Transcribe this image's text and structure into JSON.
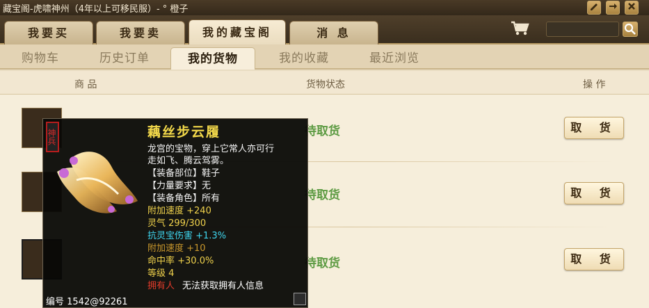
{
  "window": {
    "title": "藏宝阁-虎啸神州（4年以上可移民服）- °  橙子"
  },
  "main_tabs": [
    {
      "label": "我要买",
      "active": false
    },
    {
      "label": "我要卖",
      "active": false
    },
    {
      "label": "我的藏宝阁",
      "active": true
    },
    {
      "label": "消 息",
      "active": false
    }
  ],
  "search": {
    "value": "",
    "placeholder": ""
  },
  "sub_tabs": [
    {
      "label": "购物车",
      "active": false
    },
    {
      "label": "历史订单",
      "active": false
    },
    {
      "label": "我的货物",
      "active": true
    },
    {
      "label": "我的收藏",
      "active": false
    },
    {
      "label": "最近浏览",
      "active": false
    }
  ],
  "columns": {
    "goods": "商 品",
    "status": "货物状态",
    "action": "操 作"
  },
  "rows": [
    {
      "status": "待取货",
      "action": "取 货"
    },
    {
      "status": "待取货",
      "action": "取 货"
    },
    {
      "status": "待取货",
      "action": "取 货"
    }
  ],
  "tooltip": {
    "seal": "神兵",
    "title": "藕丝步云履",
    "desc1": "龙宫的宝物，穿上它常人亦可行",
    "desc2": "走如飞、腾云驾雾。",
    "equip_slot": "【装备部位】鞋子",
    "strength_req": "【力量要求】无",
    "equip_role": "【装备角色】所有",
    "bonus_speed": "附加速度 +240",
    "spirit": "灵气 299/300",
    "resist": "抗灵宝伤害 +1.3%",
    "bonus_speed2": "附加速度 +10",
    "hit_rate": "命中率 +30.0%",
    "level": "等级 4",
    "owner_label": "拥有人",
    "owner_value": "无法获取拥有人信息",
    "serial": "编号 1542@92261"
  },
  "colors": {
    "status_green": "#5d9b43",
    "title_yellow": "#f2d84a",
    "cyan": "#3fd7f0",
    "red": "#e23b2a"
  },
  "icons": [
    "edit-icon",
    "arrow-right-icon",
    "close-icon",
    "cart-icon",
    "search-icon"
  ]
}
